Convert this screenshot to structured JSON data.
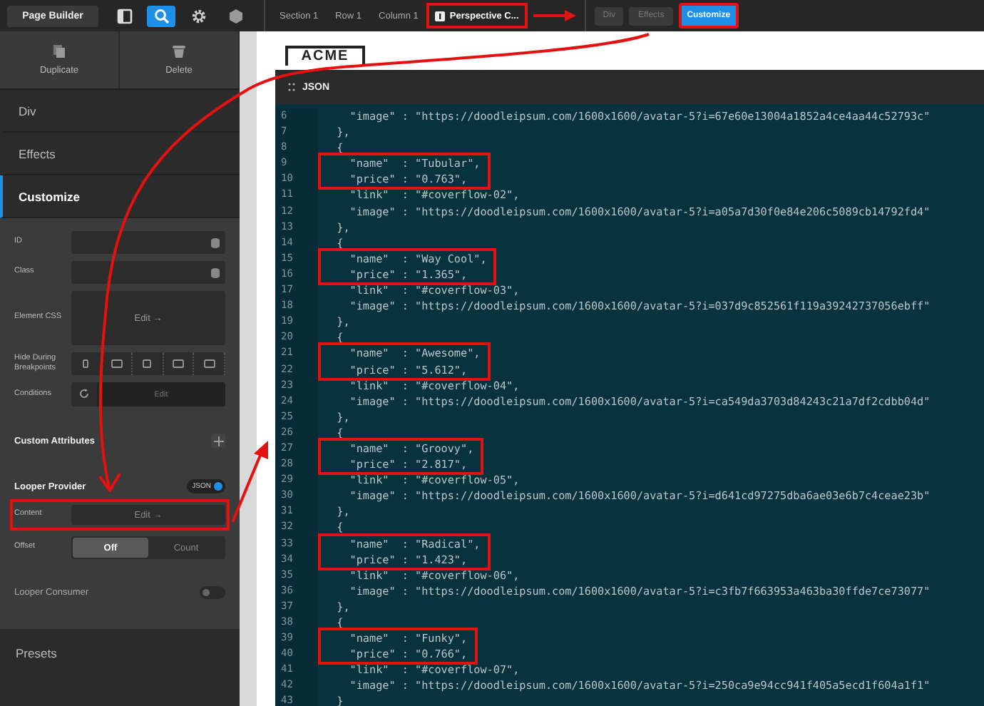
{
  "topbar": {
    "title": "Page Builder",
    "tools": [
      {
        "kind": "panel",
        "selected": false
      },
      {
        "kind": "search",
        "selected": true
      },
      {
        "kind": "settings",
        "selected": false
      },
      {
        "kind": "hexagon",
        "selected": false
      }
    ]
  },
  "breadcrumbs": [
    {
      "label": "Section 1",
      "marked": false
    },
    {
      "label": "Row 1",
      "marked": false
    },
    {
      "label": "Column 1",
      "marked": false
    },
    {
      "label": "Perspective C...",
      "marked": true
    }
  ],
  "modes": [
    {
      "label": "Div",
      "selected": false,
      "marked": false
    },
    {
      "label": "Effects",
      "selected": false,
      "marked": false
    },
    {
      "label": "Customize",
      "selected": true,
      "marked": true
    }
  ],
  "actions": [
    {
      "kind": "duplicate",
      "label": "Duplicate"
    },
    {
      "kind": "delete",
      "label": "Delete"
    }
  ],
  "nav": [
    {
      "label": "Div",
      "selected": false
    },
    {
      "label": "Effects",
      "selected": false
    },
    {
      "label": "Customize",
      "selected": true
    }
  ],
  "fields": [
    {
      "kind": "input",
      "label": "ID"
    },
    {
      "kind": "input",
      "label": "Class"
    },
    {
      "kind": "editor",
      "label": "Element CSS",
      "button": "Edit →"
    },
    {
      "kind": "breakpoints",
      "label": "Hide During Breakpoints"
    },
    {
      "kind": "conditions",
      "label": "Conditions",
      "button": "Edit"
    }
  ],
  "custom_attributes": {
    "label": "Custom Attributes"
  },
  "looper_provider": {
    "label": "Looper Provider",
    "toggle": {
      "label": "JSON",
      "on": true
    },
    "content": {
      "label": "Content",
      "button": "Edit →",
      "marked": true
    },
    "offset": {
      "label": "Offset",
      "options": [
        {
          "label": "Off",
          "selected": true
        },
        {
          "label": "Count",
          "selected": false
        }
      ]
    }
  },
  "looper_consumer": {
    "label": "Looper Consumer",
    "on": false
  },
  "presets": {
    "label": "Presets"
  },
  "logo": {
    "text": "ACME"
  },
  "json_panel": {
    "title": "JSON",
    "blocks": [
      {
        "marked": false,
        "lines": [
          {
            "n": "6",
            "text": "    \"image\" : \"https://doodleipsum.com/1600x1600/avatar-5?i=67e60e13004a1852a4ce4aa44c52793c\""
          },
          {
            "n": "7",
            "text": "  },"
          },
          {
            "n": "8",
            "text": "  {"
          }
        ]
      },
      {
        "marked": true,
        "lines": [
          {
            "n": "9",
            "text": "    \"name\"  : \"Tubular\","
          },
          {
            "n": "10",
            "text": "    \"price\" : \"0.763\","
          }
        ]
      },
      {
        "marked": false,
        "lines": [
          {
            "n": "11",
            "text": "    \"link\"  : \"#coverflow-02\","
          },
          {
            "n": "12",
            "text": "    \"image\" : \"https://doodleipsum.com/1600x1600/avatar-5?i=a05a7d30f0e84e206c5089cb14792fd4\""
          },
          {
            "n": "13",
            "text": "  },"
          },
          {
            "n": "14",
            "text": "  {"
          }
        ]
      },
      {
        "marked": true,
        "lines": [
          {
            "n": "15",
            "text": "    \"name\"  : \"Way Cool\","
          },
          {
            "n": "16",
            "text": "    \"price\" : \"1.365\","
          }
        ]
      },
      {
        "marked": false,
        "lines": [
          {
            "n": "17",
            "text": "    \"link\"  : \"#coverflow-03\","
          },
          {
            "n": "18",
            "text": "    \"image\" : \"https://doodleipsum.com/1600x1600/avatar-5?i=037d9c852561f119a39242737056ebff\""
          },
          {
            "n": "19",
            "text": "  },"
          },
          {
            "n": "20",
            "text": "  {"
          }
        ]
      },
      {
        "marked": true,
        "lines": [
          {
            "n": "21",
            "text": "    \"name\"  : \"Awesome\","
          },
          {
            "n": "22",
            "text": "    \"price\" : \"5.612\","
          }
        ]
      },
      {
        "marked": false,
        "lines": [
          {
            "n": "23",
            "text": "    \"link\"  : \"#coverflow-04\","
          },
          {
            "n": "24",
            "text": "    \"image\" : \"https://doodleipsum.com/1600x1600/avatar-5?i=ca549da3703d84243c21a7df2cdbb04d\""
          },
          {
            "n": "25",
            "text": "  },"
          },
          {
            "n": "26",
            "text": "  {"
          }
        ]
      },
      {
        "marked": true,
        "lines": [
          {
            "n": "27",
            "text": "    \"name\"  : \"Groovy\","
          },
          {
            "n": "28",
            "text": "    \"price\" : \"2.817\","
          }
        ]
      },
      {
        "marked": false,
        "lines": [
          {
            "n": "29",
            "text": "    \"link\"  : \"#coverflow-05\","
          },
          {
            "n": "30",
            "text": "    \"image\" : \"https://doodleipsum.com/1600x1600/avatar-5?i=d641cd97275dba6ae03e6b7c4ceae23b\""
          },
          {
            "n": "31",
            "text": "  },"
          },
          {
            "n": "32",
            "text": "  {"
          }
        ]
      },
      {
        "marked": true,
        "lines": [
          {
            "n": "33",
            "text": "    \"name\"  : \"Radical\","
          },
          {
            "n": "34",
            "text": "    \"price\" : \"1.423\","
          }
        ]
      },
      {
        "marked": false,
        "lines": [
          {
            "n": "35",
            "text": "    \"link\"  : \"#coverflow-06\","
          },
          {
            "n": "36",
            "text": "    \"image\" : \"https://doodleipsum.com/1600x1600/avatar-5?i=c3fb7f663953a463ba30ffde7ce73077\""
          },
          {
            "n": "37",
            "text": "  },"
          },
          {
            "n": "38",
            "text": "  {"
          }
        ]
      },
      {
        "marked": true,
        "lines": [
          {
            "n": "39",
            "text": "    \"name\"  : \"Funky\","
          },
          {
            "n": "40",
            "text": "    \"price\" : \"0.766\","
          }
        ]
      },
      {
        "marked": false,
        "lines": [
          {
            "n": "41",
            "text": "    \"link\"  : \"#coverflow-07\","
          },
          {
            "n": "42",
            "text": "    \"image\" : \"https://doodleipsum.com/1600x1600/avatar-5?i=250ca9e94cc941f405a5ecd1f604a1f1\""
          },
          {
            "n": "43",
            "text": "  }"
          }
        ]
      }
    ]
  }
}
